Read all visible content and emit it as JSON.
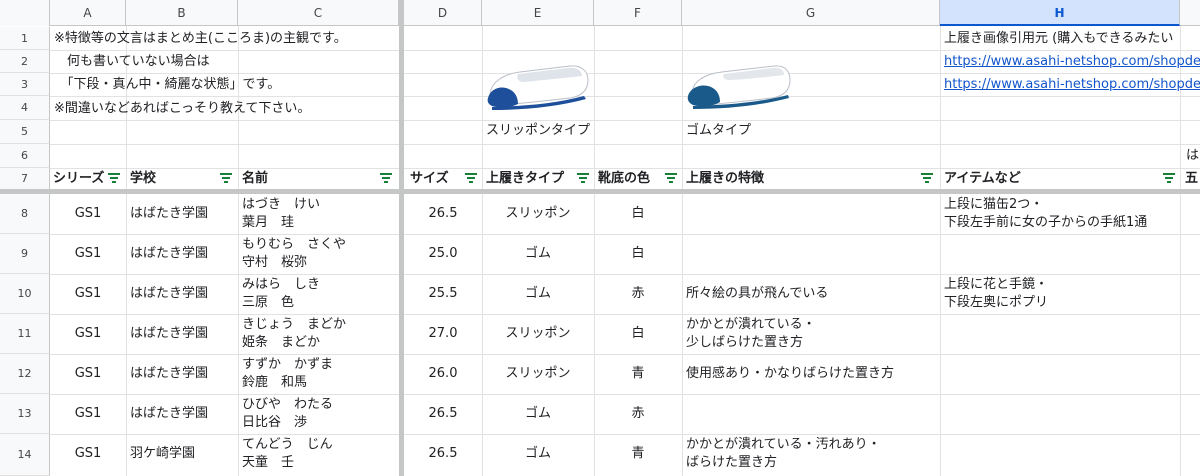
{
  "columns": [
    "A",
    "B",
    "C",
    "D",
    "E",
    "F",
    "G",
    "H"
  ],
  "rows": [
    "1",
    "2",
    "3",
    "4",
    "5",
    "6",
    "7",
    "8",
    "9",
    "10",
    "11",
    "12",
    "13",
    "14"
  ],
  "notes": [
    "※特徴等の文言はまとめ主(こころま)の主観です。",
    "　何も書いていない場合は",
    "　「下段・真ん中・綺麗な状態」です。",
    "※間違いなどあればこっそり教えて下さい。"
  ],
  "shoe_types": {
    "slipon_label": "スリッポンタイプ",
    "gom_label": "ゴムタイプ"
  },
  "source": {
    "title": "上履き画像引用元 (購入もできるみたい",
    "link1": "https://www.asahi-netshop.com/shopdet",
    "link2": "https://www.asahi-netshop.com/shopdet"
  },
  "row6_h_partial": "は",
  "headers": {
    "series": "シリーズ",
    "school": "学校",
    "name": "名前",
    "size": "サイズ",
    "type": "上履きタイプ",
    "sole": "靴底の色",
    "feature": "上履きの特徴",
    "items": "アイテムなど",
    "next_partial": "五"
  },
  "data_rows": [
    {
      "series": "GS1",
      "school": "はばたき学園",
      "kana": "はづき　けい",
      "kanji": "葉月　珪",
      "size": "26.5",
      "type": "スリッポン",
      "sole": "白",
      "feature1": "",
      "feature2": "",
      "items1": "上段に猫缶2つ・",
      "items2": "下段左手前に女の子からの手紙1通"
    },
    {
      "series": "GS1",
      "school": "はばたき学園",
      "kana": "もりむら　さくや",
      "kanji": "守村　桜弥",
      "size": "25.0",
      "type": "ゴム",
      "sole": "白",
      "feature1": "",
      "feature2": "",
      "items1": "",
      "items2": ""
    },
    {
      "series": "GS1",
      "school": "はばたき学園",
      "kana": "みはら　しき",
      "kanji": "三原　色",
      "size": "25.5",
      "type": "ゴム",
      "sole": "赤",
      "feature1": "所々絵の具が飛んでいる",
      "feature2": "",
      "items1": "上段に花と手鏡・",
      "items2": "下段左奥にポプリ"
    },
    {
      "series": "GS1",
      "school": "はばたき学園",
      "kana": "きじょう　まどか",
      "kanji": "姫条　まどか",
      "size": "27.0",
      "type": "スリッポン",
      "sole": "白",
      "feature1": "かかとが潰れている・",
      "feature2": "少しばらけた置き方",
      "items1": "",
      "items2": ""
    },
    {
      "series": "GS1",
      "school": "はばたき学園",
      "kana": "すずか　かずま",
      "kanji": "鈴鹿　和馬",
      "size": "26.0",
      "type": "スリッポン",
      "sole": "青",
      "feature1": "使用感あり・かなりばらけた置き方",
      "feature2": "",
      "items1": "",
      "items2": ""
    },
    {
      "series": "GS1",
      "school": "はばたき学園",
      "kana": "ひびや　わたる",
      "kanji": "日比谷　渉",
      "size": "26.5",
      "type": "ゴム",
      "sole": "赤",
      "feature1": "",
      "feature2": "",
      "items1": "",
      "items2": ""
    },
    {
      "series": "GS1",
      "school": "羽ケ崎学園",
      "kana": "てんどう　じん",
      "kanji": "天童　壬",
      "size": "26.5",
      "type": "ゴム",
      "sole": "青",
      "feature1": "かかとが潰れている・汚れあり・",
      "feature2": "ばらけた置き方",
      "items1": "",
      "items2": ""
    }
  ],
  "colors": {
    "filter_green": "#188038",
    "link": "#1155cc",
    "shoe_sole": "#1e4f9a",
    "shoe_sole_gom": "#1a5a8a"
  }
}
